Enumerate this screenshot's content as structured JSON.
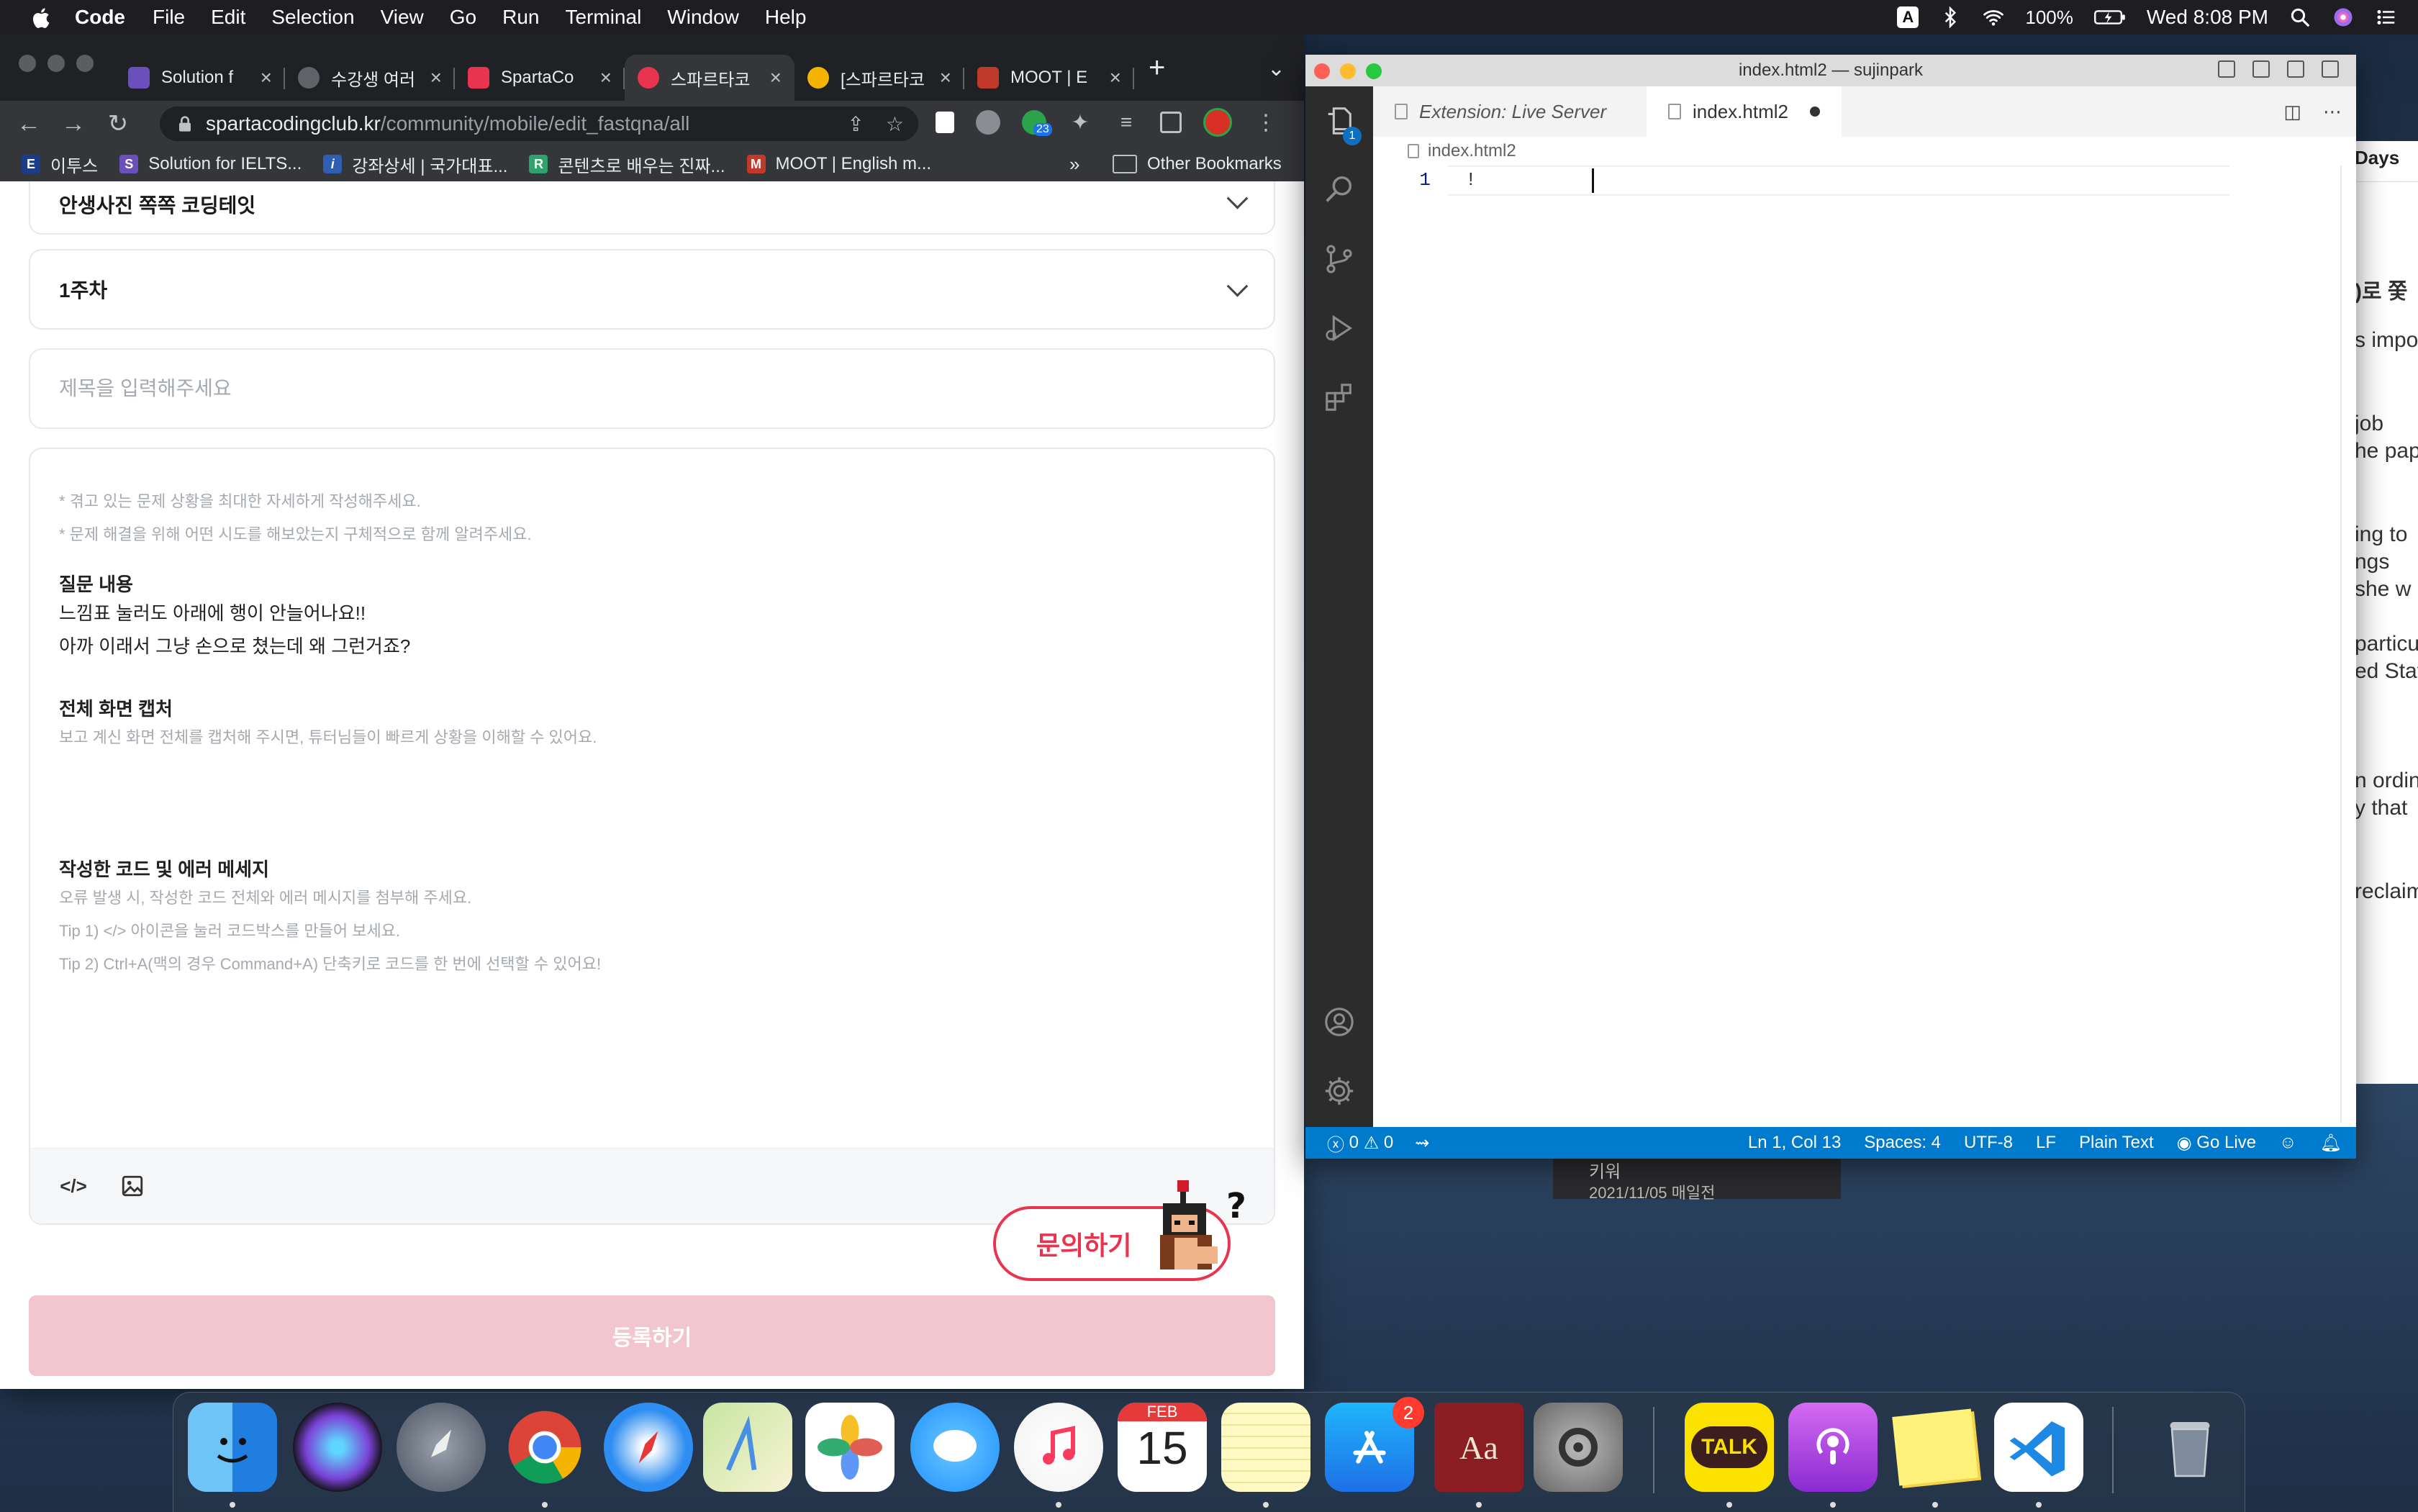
{
  "menubar": {
    "app_name": "Code",
    "items": [
      "File",
      "Edit",
      "Selection",
      "View",
      "Go",
      "Run",
      "Terminal",
      "Window",
      "Help"
    ],
    "input_source": "A",
    "battery": "100%",
    "clock": "Wed 8:08 PM"
  },
  "chrome": {
    "tabs": [
      {
        "label": "Solution f",
        "favicon_color": "#6b4fbb",
        "active": false
      },
      {
        "label": "수강생 여러",
        "favicon_color": "#5f6368",
        "active": false
      },
      {
        "label": "SpartaCo",
        "favicon_color": "#e8344e",
        "active": false
      },
      {
        "label": "스파르타코",
        "favicon_color": "#e8344e",
        "active": true
      },
      {
        "label": "[스파르타코",
        "favicon_color": "#f5b400",
        "active": false
      },
      {
        "label": "MOOT | E",
        "favicon_color": "#c0392b",
        "active": false
      }
    ],
    "url_host": "spartacodingclub.kr",
    "url_path": "/community/mobile/edit_fastqna/all",
    "extension_badge": "23",
    "bookmarks": [
      {
        "label": "이투스",
        "icon": "E",
        "color": "#1d3b8b"
      },
      {
        "label": "Solution for IELTS...",
        "icon": "S",
        "color": "#6b4fbb"
      },
      {
        "label": "강좌상세 | 국가대표...",
        "icon": "i",
        "color": "#2f5fb3"
      },
      {
        "label": "콘텐츠로 배우는 진짜...",
        "icon": "R",
        "color": "#2fa36b"
      },
      {
        "label": "MOOT | English m...",
        "icon": "M",
        "color": "#c0392b"
      }
    ],
    "bookmarks_more": "»",
    "other_bookmarks": "Other Bookmarks"
  },
  "page": {
    "course_select": "안생사진 쪽쪽 코딩테잇",
    "week_select": "1주차",
    "title_placeholder": "제목을 입력해주세요",
    "hint1": "* 겪고 있는 문제 상황을 최대한 자세하게 작성해주세요.",
    "hint2": "* 문제 해결을 위해 어떤 시도를 해보았는지 구체적으로 함께 알려주세요.",
    "question_heading": "질문 내용",
    "question_line1": "느낌표 눌러도 아래에 행이 안늘어나요!!",
    "question_line2": "아까 이래서 그냥 손으로 쳤는데 왜 그런거죠?",
    "capture_heading": "전체 화면 캡처",
    "capture_hint": "보고 계신 화면 전체를 캡처해 주시면, 튜터님들이 빠르게 상황을 이해할 수 있어요.",
    "code_heading": "작성한 코드 및 에러 메세지",
    "code_hint1": "오류 발생 시, 작성한 코드 전체와 에러 메시지를 첨부해 주세요.",
    "code_hint2": "Tip 1) </> 아이콘을 눌러 코드박스를 만들어 보세요.",
    "code_hint3": "Tip 2) Ctrl+A(맥의 경우 Command+A) 단축키로 코드를 한 번에 선택할 수 있어요!",
    "code_icon": "</>",
    "ask_button": "문의하기",
    "submit_button": "등록하기"
  },
  "vscode": {
    "window_title": "index.html2 — sujinpark",
    "tab_preview": "Extension: Live Server",
    "tab_active": "index.html2",
    "breadcrumb": "index.html2",
    "line_number": "1",
    "line_text": "!",
    "explorer_badge": "1",
    "status": {
      "errors": "0",
      "warnings": "0",
      "position": "Ln 1, Col 13",
      "spaces": "Spaces: 4",
      "encoding": "UTF-8",
      "eol": "LF",
      "language": "Plain Text",
      "golive": "Go Live"
    }
  },
  "background_window": {
    "days": "Days",
    "lines": [
      ")로 쫓",
      "s impo",
      "job",
      "he pap",
      "ing to",
      "ngs",
      " she w",
      "particu",
      "ed Stat",
      "n ordin",
      "y that",
      "reclaim"
    ],
    "card_title": "키워",
    "card_date": "2021/11/05 매일전"
  },
  "dock": {
    "appstore_badge": "2",
    "calendar_month": "FEB",
    "calendar_day": "15",
    "talk_label": "TALK"
  }
}
